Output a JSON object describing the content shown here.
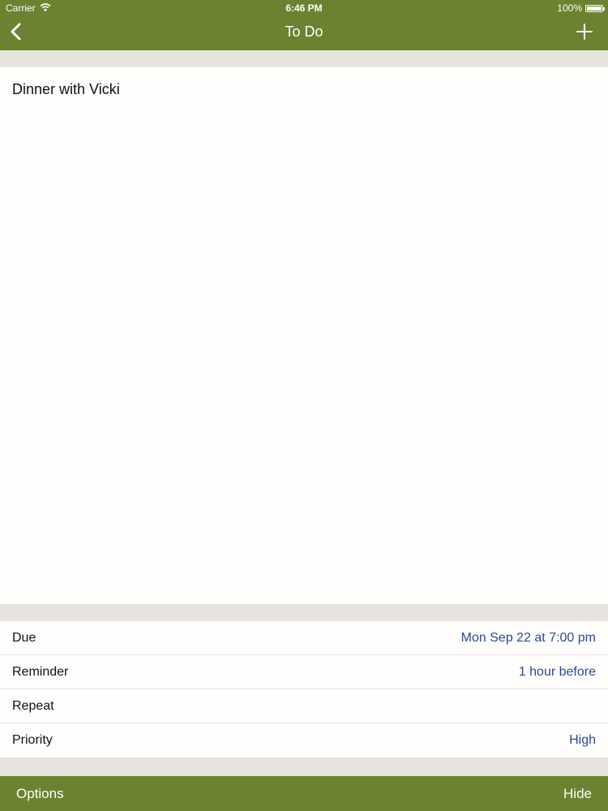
{
  "status_bar": {
    "carrier": "Carrier",
    "time": "6:46 PM",
    "battery": "100%",
    "battery_level": 1.0,
    "icons": [
      "wifi-icon",
      "battery-icon"
    ]
  },
  "navbar": {
    "title": "To Do",
    "back_icon": "chevron-left-icon",
    "add_icon": "plus-icon"
  },
  "note": {
    "text": "Dinner with Vicki"
  },
  "details": [
    {
      "label": "Due",
      "value": "Mon Sep 22 at 7:00 pm"
    },
    {
      "label": "Reminder",
      "value": "1 hour before"
    },
    {
      "label": "Repeat",
      "value": ""
    },
    {
      "label": "Priority",
      "value": "High"
    }
  ],
  "toolbar": {
    "options_label": "Options",
    "hide_label": "Hide"
  },
  "colors": {
    "bar": "#6b8231",
    "separator": "#e6e4dd",
    "value_text": "#2a4a97"
  }
}
